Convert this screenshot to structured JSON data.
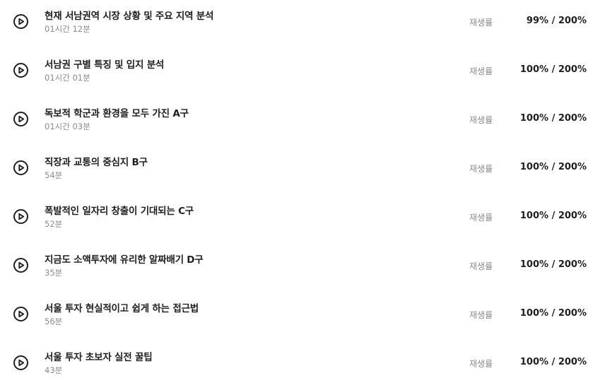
{
  "rate_label": "재생률",
  "lectures": [
    {
      "title": "현재 서남권역 시장 상황 및 주요 지역 분석",
      "duration": "01시간 12분",
      "progress": "99% / 200%"
    },
    {
      "title": "서남권 구별 특징 및 입지 분석",
      "duration": "01시간 01분",
      "progress": "100% / 200%"
    },
    {
      "title": "독보적 학군과 환경을 모두 가진 A구",
      "duration": "01시간 03분",
      "progress": "100% / 200%"
    },
    {
      "title": "직장과 교통의 중심지 B구",
      "duration": "54분",
      "progress": "100% / 200%"
    },
    {
      "title": "폭발적인 일자리 창출이 기대되는 C구",
      "duration": "52분",
      "progress": "100% / 200%"
    },
    {
      "title": "지금도 소액투자에 유리한 알짜배기 D구",
      "duration": "35분",
      "progress": "100% / 200%"
    },
    {
      "title": "서울 투자 현실적이고 쉽게 하는 접근법",
      "duration": "56분",
      "progress": "100% / 200%"
    },
    {
      "title": "서울 투자 초보자 실전 꿀팁",
      "duration": "43분",
      "progress": "100% / 200%"
    }
  ]
}
